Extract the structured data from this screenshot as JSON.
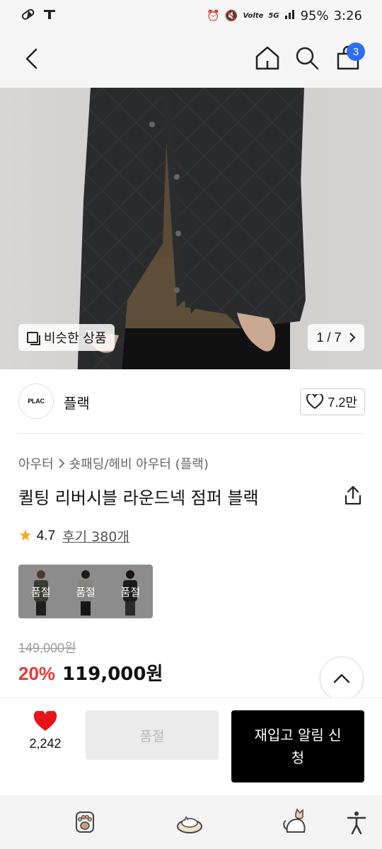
{
  "status_bar": {
    "battery": "95%",
    "time": "3:26",
    "network": "5G",
    "carrier_label": "Volte"
  },
  "top_nav": {
    "cart_count": "3"
  },
  "gallery": {
    "similar_label": "비슷한 상품",
    "counter": "1 / 7"
  },
  "brand": {
    "logo_text": "PLAC",
    "name": "플랙",
    "likes": "7.2만"
  },
  "breadcrumb": {
    "category": "아우터",
    "subcategory": "숏패딩/헤비 아우터 (플랙)"
  },
  "product": {
    "title": "퀼팅 리버시블 라운드넥 점퍼 블랙",
    "rating": "4.7",
    "reviews": "후기 380개",
    "variants": [
      {
        "status": "품절",
        "color": "#5b5f52"
      },
      {
        "status": "품절",
        "color": "#d9d5cc"
      },
      {
        "status": "품절",
        "color": "#2a2a2a"
      }
    ],
    "original_price": "149,000원",
    "discount": "20%",
    "sale_price": "119,000원"
  },
  "action_bar": {
    "wish_count": "2,242",
    "soldout_label": "품절",
    "restock_label": "재입고 알림 신청"
  }
}
